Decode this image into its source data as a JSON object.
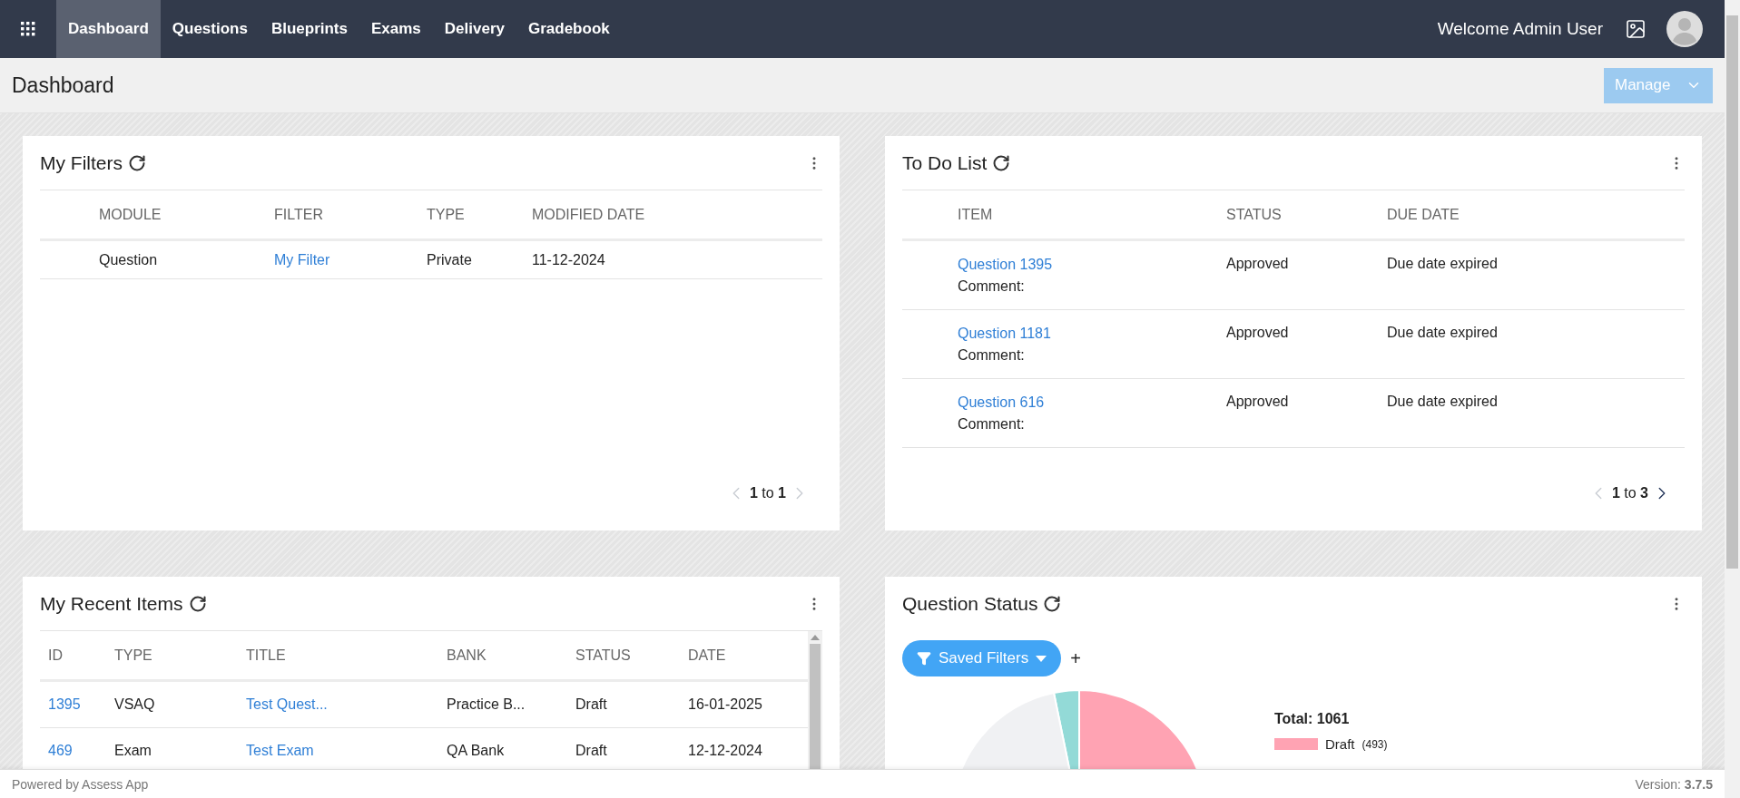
{
  "nav": {
    "items": [
      {
        "label": "Dashboard",
        "selected": true
      },
      {
        "label": "Questions",
        "selected": false
      },
      {
        "label": "Blueprints",
        "selected": false
      },
      {
        "label": "Exams",
        "selected": false
      },
      {
        "label": "Delivery",
        "selected": false
      },
      {
        "label": "Gradebook",
        "selected": false
      }
    ],
    "welcome": "Welcome Admin User"
  },
  "page": {
    "title": "Dashboard",
    "manage_button": "Manage"
  },
  "my_filters": {
    "title": "My Filters",
    "columns": [
      "MODULE",
      "FILTER",
      "TYPE",
      "MODIFIED DATE"
    ],
    "rows": [
      {
        "module": "Question",
        "filter": "My Filter",
        "type": "Private",
        "modified_date": "11-12-2024"
      }
    ],
    "pagination": {
      "text": "**1** to **1**",
      "prev_disabled": true,
      "next_disabled": true
    }
  },
  "todo": {
    "title": "To Do List",
    "columns": [
      "ITEM",
      "STATUS",
      "DUE DATE"
    ],
    "rows": [
      {
        "item": "Question 1395",
        "comment": "Comment:",
        "status": "Approved",
        "due_date": "Due date expired"
      },
      {
        "item": "Question 1181",
        "comment": "Comment:",
        "status": "Approved",
        "due_date": "Due date expired"
      },
      {
        "item": "Question 616",
        "comment": "Comment:",
        "status": "Approved",
        "due_date": "Due date expired"
      }
    ],
    "pagination": {
      "text": "**1** to **3**",
      "prev_disabled": true,
      "next_disabled": false
    }
  },
  "recent": {
    "title": "My Recent Items",
    "columns": [
      "ID",
      "TYPE",
      "TITLE",
      "BANK",
      "STATUS",
      "DATE"
    ],
    "rows": [
      {
        "id": "1395",
        "type": "VSAQ",
        "title": "Test Quest...",
        "bank": "Practice B...",
        "status": "Draft",
        "date": "16-01-2025"
      },
      {
        "id": "469",
        "type": "Exam",
        "title": "Test Exam",
        "bank": "QA Bank",
        "status": "Draft",
        "date": "12-12-2024"
      }
    ]
  },
  "question_status": {
    "title": "Question Status",
    "filter_button": "Saved Filters",
    "add": "+",
    "total": "Total: 1061",
    "legend": [
      {
        "label": "Draft",
        "count": "(493)",
        "color": "#ffa3b3"
      }
    ]
  },
  "footer": {
    "powered": "Powered by Assess App",
    "version": "Version: **3.7.5**"
  }
}
